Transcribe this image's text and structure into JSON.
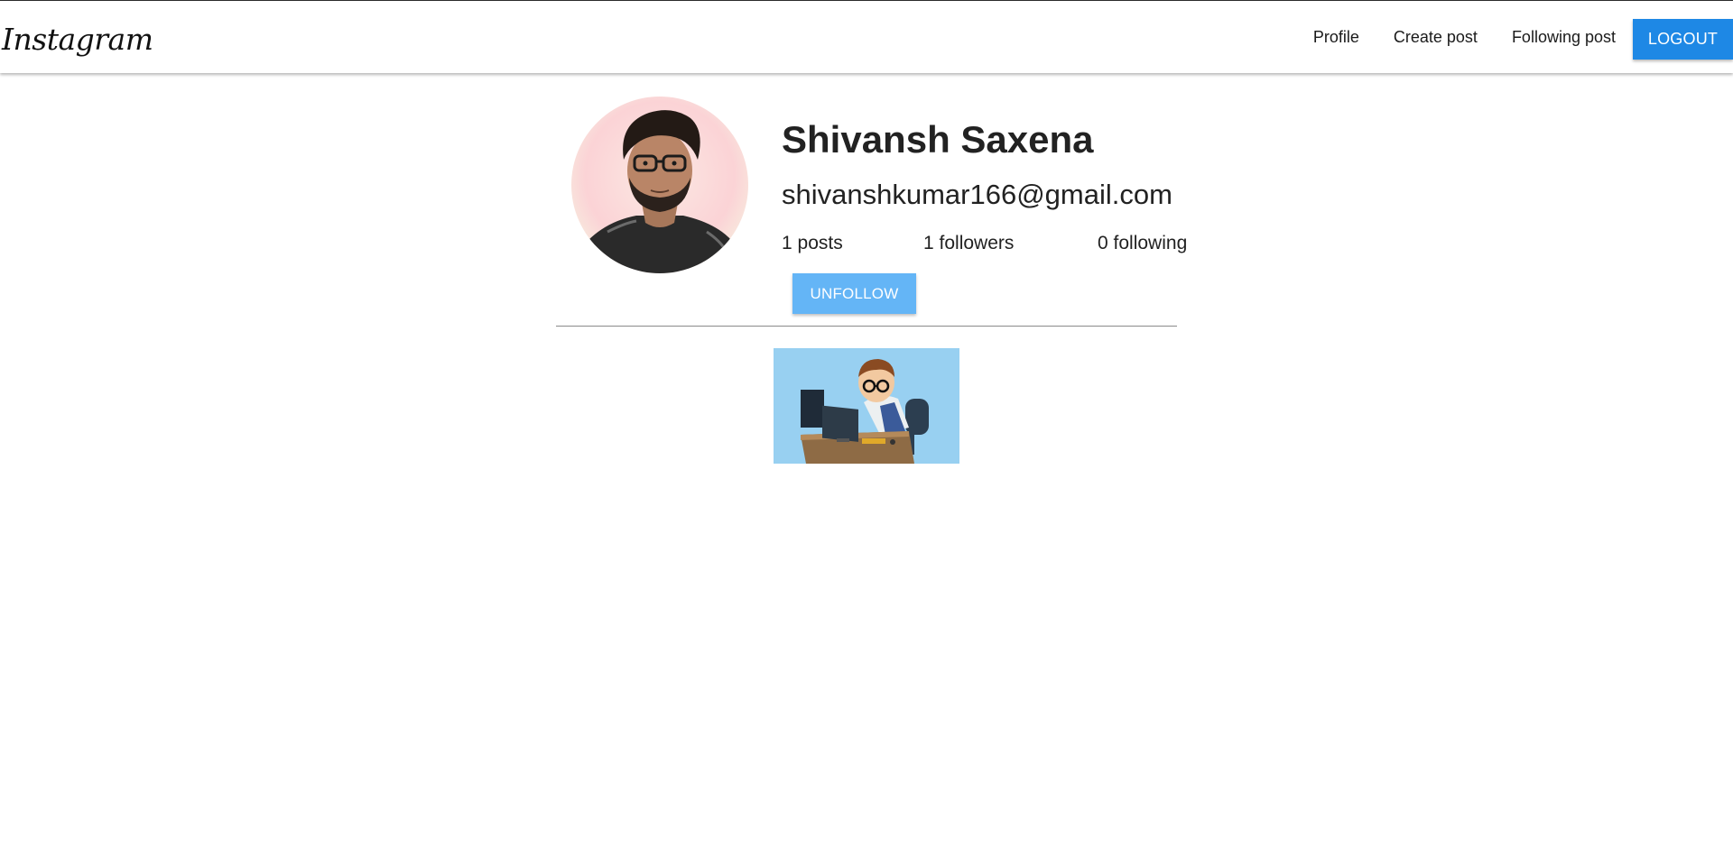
{
  "navbar": {
    "brand": "Instagram",
    "links": [
      "Profile",
      "Create post",
      "Following post"
    ],
    "logout_label": "LOGOUT"
  },
  "profile": {
    "name": "Shivansh Saxena",
    "email": "shivanshkumar166@gmail.com",
    "stats": {
      "posts": {
        "count": "1",
        "label": "posts"
      },
      "followers": {
        "count": "1",
        "label": "followers"
      },
      "following": {
        "count": "0",
        "label": "following"
      }
    },
    "unfollow_label": "UNFOLLOW"
  },
  "colors": {
    "logout_button": "#1e88e5",
    "unfollow_button": "#64b5f6",
    "divider": "#8a8a8a"
  },
  "posts": [
    {
      "image": "cartoon-programmer-at-desk"
    }
  ]
}
